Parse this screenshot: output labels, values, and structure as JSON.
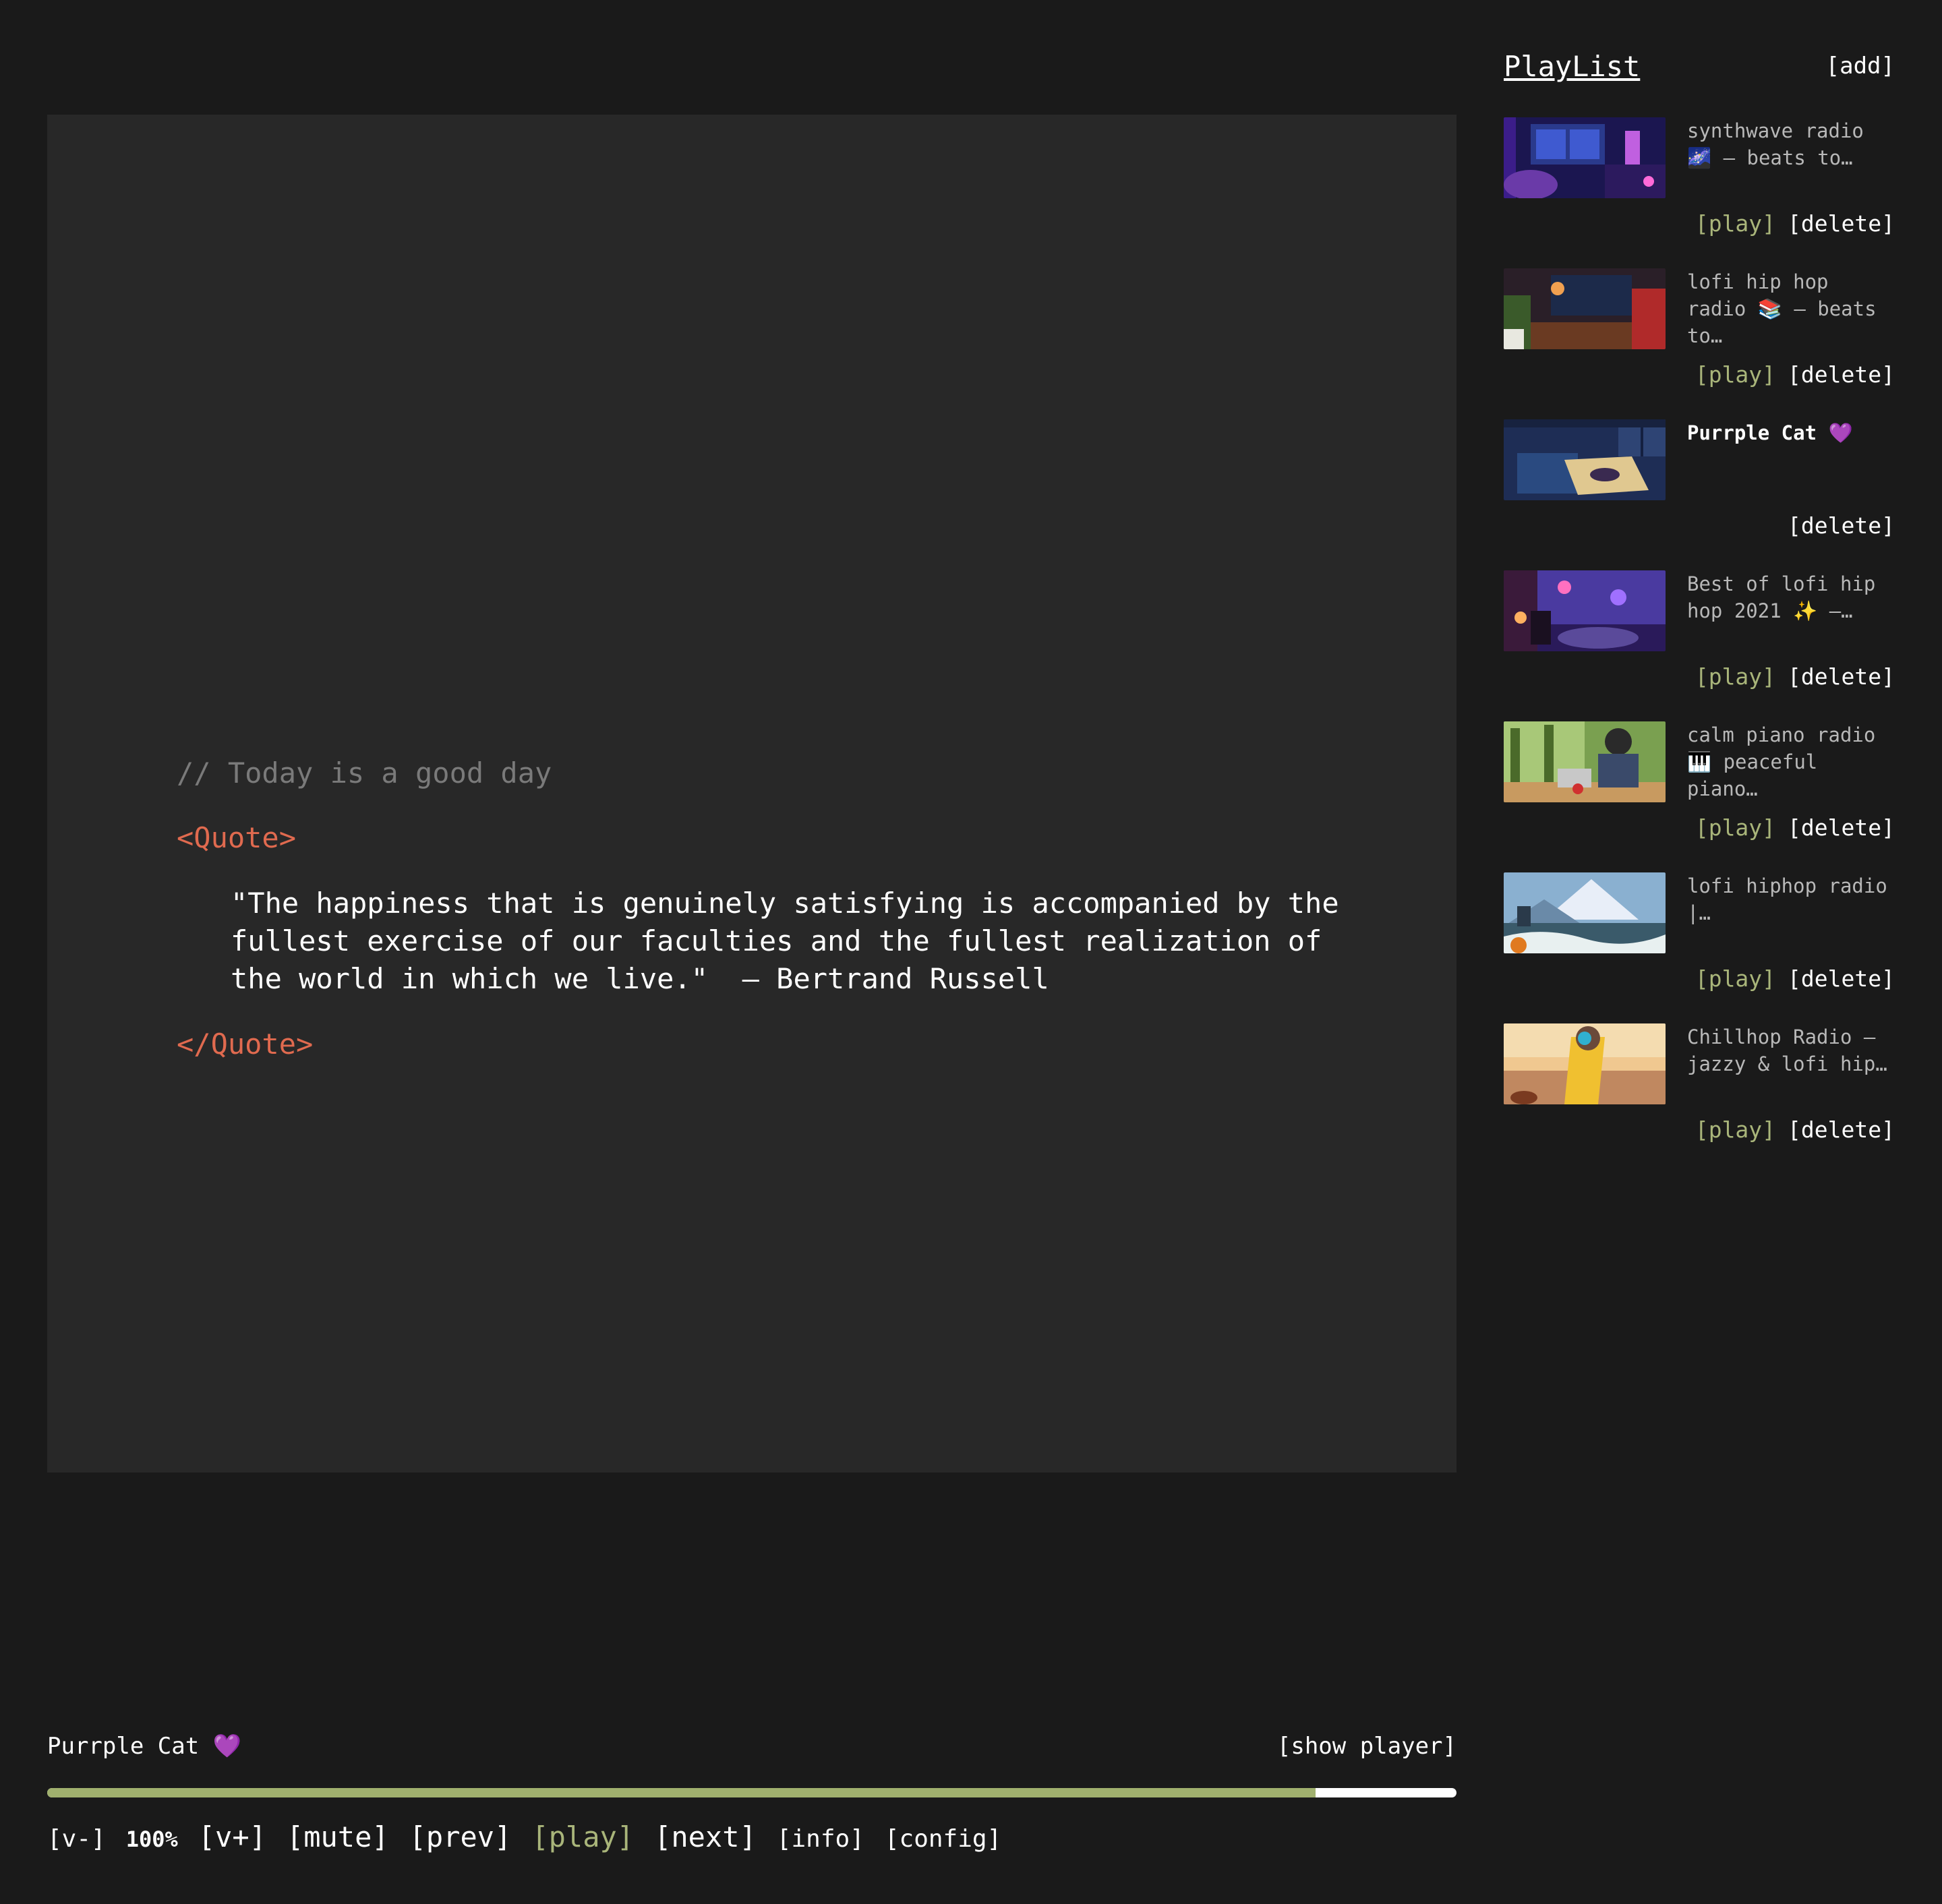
{
  "quote": {
    "comment": "// Today is a good day",
    "open_tag": "<Quote>",
    "text": "\"The happiness that is genuinely satisfying is accompanied by the fullest exercise of our faculties and the fullest realization of the world in which we live.\"  — Bertrand Russell",
    "close_tag": "</Quote>"
  },
  "playlist": {
    "title": "PlayList",
    "add_label": "[add]",
    "items": [
      {
        "title": "synthwave radio 🌌 – beats to…",
        "play": "[play]",
        "delete": "[delete]",
        "active": false
      },
      {
        "title": "lofi hip hop radio 📚 – beats to…",
        "play": "[play]",
        "delete": "[delete]",
        "active": false
      },
      {
        "title": "Purrple Cat 💜",
        "play": "",
        "delete": "[delete]",
        "active": true
      },
      {
        "title": "Best of lofi hip hop 2021 ✨ –…",
        "play": "[play]",
        "delete": "[delete]",
        "active": false
      },
      {
        "title": "calm piano radio🎹 peaceful piano…",
        "play": "[play]",
        "delete": "[delete]",
        "active": false
      },
      {
        "title": "lofi hiphop radio |…",
        "play": "[play]",
        "delete": "[delete]",
        "active": false
      },
      {
        "title": "Chillhop Radio – jazzy & lofi hip…",
        "play": "[play]",
        "delete": "[delete]",
        "active": false
      }
    ]
  },
  "player": {
    "now_playing": "Purrple Cat 💜",
    "show_player": "[show player]",
    "progress": 0.9,
    "controls": {
      "vol_down": "[v-]",
      "volume": "100%",
      "vol_up": "[v+]",
      "mute": "[mute]",
      "prev": "[prev]",
      "play": "[play]",
      "next": "[next]",
      "info": "[info]",
      "config": "[config]"
    }
  },
  "colors": {
    "background": "#1a1a1a",
    "panel": "#282828",
    "accent_green": "#a9b57a",
    "tag_orange": "#e06a4f",
    "comment_gray": "#7a7a7a"
  }
}
